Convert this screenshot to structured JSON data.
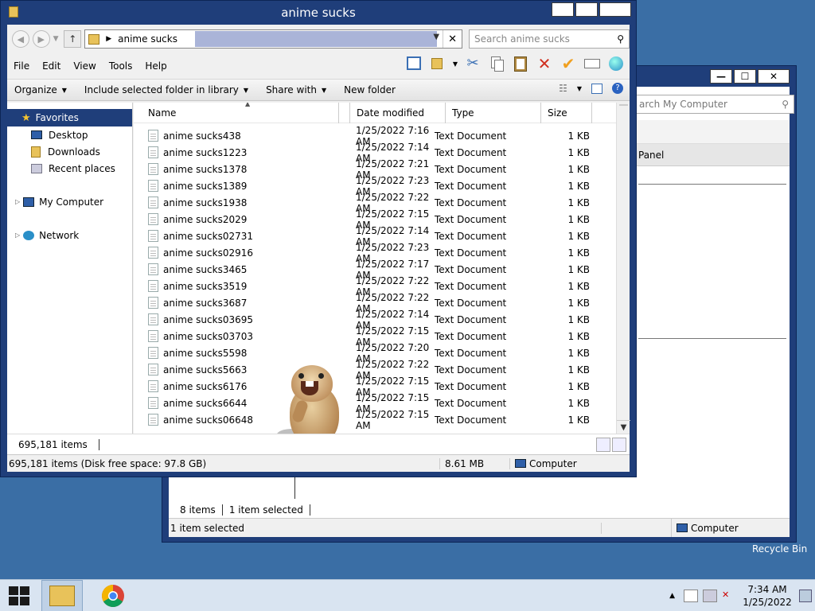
{
  "front_window": {
    "title": "anime sucks",
    "address": {
      "crumb": "anime sucks"
    },
    "search": {
      "placeholder": "Search anime sucks"
    },
    "menu": [
      "File",
      "Edit",
      "View",
      "Tools",
      "Help"
    ],
    "commands": [
      "Organize",
      "Include selected folder in library",
      "Share with",
      "New folder"
    ],
    "nav": {
      "favorites": "Favorites",
      "fav_items": [
        "Desktop",
        "Downloads",
        "Recent places"
      ],
      "my_computer": "My Computer",
      "network": "Network"
    },
    "columns": [
      "Name",
      "Date modified",
      "Type",
      "Size"
    ],
    "files": [
      {
        "name": "anime sucks438",
        "date": "1/25/2022 7:16 AM",
        "type": "Text Document",
        "size": "1 KB"
      },
      {
        "name": "anime sucks1223",
        "date": "1/25/2022 7:14 AM",
        "type": "Text Document",
        "size": "1 KB"
      },
      {
        "name": "anime sucks1378",
        "date": "1/25/2022 7:21 AM",
        "type": "Text Document",
        "size": "1 KB"
      },
      {
        "name": "anime sucks1389",
        "date": "1/25/2022 7:23 AM",
        "type": "Text Document",
        "size": "1 KB"
      },
      {
        "name": "anime sucks1938",
        "date": "1/25/2022 7:22 AM",
        "type": "Text Document",
        "size": "1 KB"
      },
      {
        "name": "anime sucks2029",
        "date": "1/25/2022 7:15 AM",
        "type": "Text Document",
        "size": "1 KB"
      },
      {
        "name": "anime sucks02731",
        "date": "1/25/2022 7:14 AM",
        "type": "Text Document",
        "size": "1 KB"
      },
      {
        "name": "anime sucks02916",
        "date": "1/25/2022 7:23 AM",
        "type": "Text Document",
        "size": "1 KB"
      },
      {
        "name": "anime sucks3465",
        "date": "1/25/2022 7:17 AM",
        "type": "Text Document",
        "size": "1 KB"
      },
      {
        "name": "anime sucks3519",
        "date": "1/25/2022 7:22 AM",
        "type": "Text Document",
        "size": "1 KB"
      },
      {
        "name": "anime sucks3687",
        "date": "1/25/2022 7:22 AM",
        "type": "Text Document",
        "size": "1 KB"
      },
      {
        "name": "anime sucks03695",
        "date": "1/25/2022 7:14 AM",
        "type": "Text Document",
        "size": "1 KB"
      },
      {
        "name": "anime sucks03703",
        "date": "1/25/2022 7:15 AM",
        "type": "Text Document",
        "size": "1 KB"
      },
      {
        "name": "anime sucks5598",
        "date": "1/25/2022 7:20 AM",
        "type": "Text Document",
        "size": "1 KB"
      },
      {
        "name": "anime sucks5663",
        "date": "1/25/2022 7:22 AM",
        "type": "Text Document",
        "size": "1 KB"
      },
      {
        "name": "anime sucks6176",
        "date": "1/25/2022 7:15 AM",
        "type": "Text Document",
        "size": "1 KB"
      },
      {
        "name": "anime sucks6644",
        "date": "1/25/2022 7:15 AM",
        "type": "Text Document",
        "size": "1 KB"
      },
      {
        "name": "anime sucks06648",
        "date": "1/25/2022 7:15 AM",
        "type": "Text Document",
        "size": "1 KB"
      }
    ],
    "status_count": "695,181 items",
    "status_bar": {
      "info": "695,181 items (Disk free space: 97.8 GB)",
      "size": "8.61 MB",
      "location": "Computer"
    }
  },
  "back_window": {
    "search_placeholder": "arch My Computer",
    "panel_label": "Panel",
    "status_count": "8 items",
    "status_selected": "1 item selected",
    "status_bar_selected": "1 item selected",
    "location": "Computer"
  },
  "desktop": {
    "recycle_bin": "Recycle Bin"
  },
  "taskbar": {
    "time": "7:34 AM",
    "date": "1/25/2022"
  },
  "colors": {
    "title_bar": "#1f3e7a",
    "desktop": "#3a6ea5",
    "selection": "#aab4d8"
  },
  "icons": [
    "folder-icon",
    "star-icon",
    "desktop-icon",
    "downloads-icon",
    "recent-places-icon",
    "computer-icon",
    "network-icon",
    "text-document-icon",
    "windows-logo-icon",
    "chrome-icon",
    "file-explorer-icon"
  ]
}
